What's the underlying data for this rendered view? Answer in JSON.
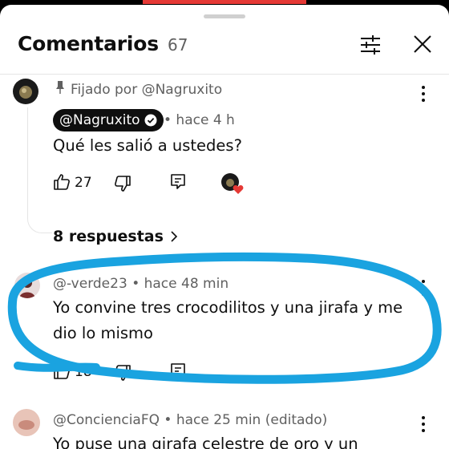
{
  "header": {
    "title": "Comentarios",
    "count": "67"
  },
  "pinned_comment": {
    "pinned_label": "Fijado por @Nagruxito",
    "author": "@Nagruxito",
    "time": "• hace 4 h",
    "text": "Qué les salió a ustedes?",
    "likes": "27",
    "replies_label": "8 respuestas"
  },
  "comment_2": {
    "author": "@-verde23",
    "time": "• hace 48 min",
    "text_line1": "Yo convine tres crocodilitos y una jirafa y me",
    "text_line2": "dio lo mismo",
    "likes": "18"
  },
  "comment_3": {
    "author": "@ConcienciaFQ",
    "time": "• hace 25 min (editado)",
    "text_line1": "Yo puse una girafa celestre de oro y un"
  },
  "colors": {
    "highlight_stroke": "#1aa3e0",
    "heart": "#e53935"
  },
  "icons": [
    "filter-icon",
    "close-icon",
    "pin-icon",
    "verified-icon",
    "like-icon",
    "dislike-icon",
    "reply-icon",
    "heart-icon",
    "chevron-right-icon",
    "more-vert-icon"
  ]
}
